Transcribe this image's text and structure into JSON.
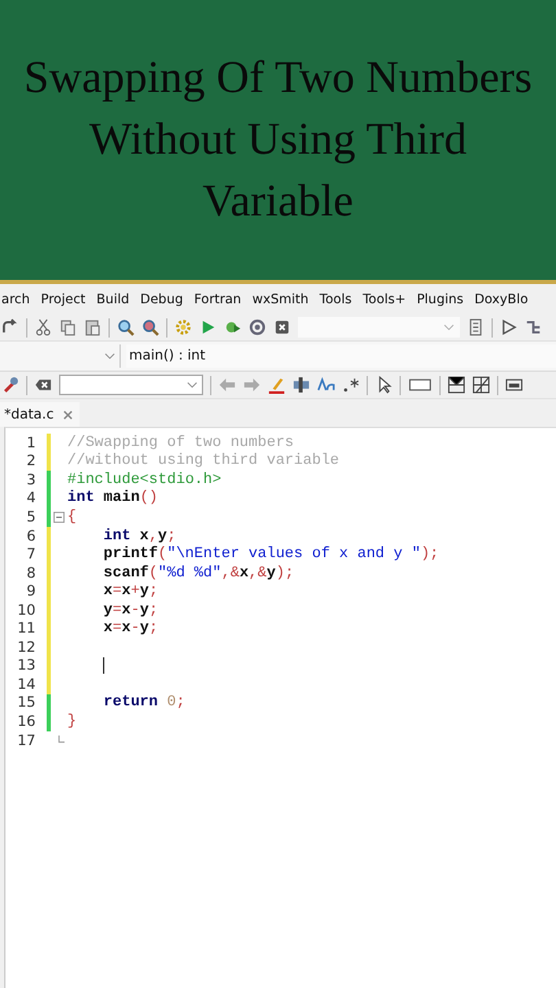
{
  "banner": {
    "title": "Swapping Of Two Numbers Without Using Third Variable"
  },
  "menu": [
    "arch",
    "Project",
    "Build",
    "Debug",
    "Fortran",
    "wxSmith",
    "Tools",
    "Tools+",
    "Plugins",
    "DoxyBlo"
  ],
  "scope": {
    "function": "main() : int"
  },
  "tabs": [
    {
      "label": "*data.c",
      "selected": true
    }
  ],
  "editor": {
    "lines": [
      {
        "number": "1",
        "saved": false,
        "indent": false,
        "tokens": [
          {
            "kind": "comment",
            "text": "//Swapping of two numbers"
          }
        ]
      },
      {
        "number": "2",
        "saved": false,
        "indent": false,
        "tokens": [
          {
            "kind": "comment",
            "text": "//without using third variable"
          }
        ]
      },
      {
        "number": "3",
        "saved": true,
        "indent": false,
        "tokens": [
          {
            "kind": "preproc",
            "text": "#include<stdio.h>"
          }
        ]
      },
      {
        "number": "4",
        "saved": true,
        "indent": false,
        "tokens": [
          {
            "kind": "keyword",
            "text": "int"
          },
          {
            "kind": "plain",
            "text": " main"
          },
          {
            "kind": "punct",
            "text": "()"
          }
        ]
      },
      {
        "number": "5",
        "saved": true,
        "indent": false,
        "fold": true,
        "tokens": [
          {
            "kind": "punct",
            "text": "{"
          }
        ]
      },
      {
        "number": "6",
        "saved": false,
        "indent": true,
        "tokens": [
          {
            "kind": "keyword",
            "text": "int"
          },
          {
            "kind": "plain",
            "text": " x"
          },
          {
            "kind": "punct",
            "text": ","
          },
          {
            "kind": "plain",
            "text": "y"
          },
          {
            "kind": "punct",
            "text": ";"
          }
        ]
      },
      {
        "number": "7",
        "saved": false,
        "indent": true,
        "tokens": [
          {
            "kind": "plain",
            "text": "printf"
          },
          {
            "kind": "punct",
            "text": "("
          },
          {
            "kind": "string",
            "text": "\"\\nEnter values of x and y \""
          },
          {
            "kind": "punct",
            "text": ");"
          }
        ]
      },
      {
        "number": "8",
        "saved": false,
        "indent": true,
        "tokens": [
          {
            "kind": "plain",
            "text": "scanf"
          },
          {
            "kind": "punct",
            "text": "("
          },
          {
            "kind": "string",
            "text": "\"%d %d\""
          },
          {
            "kind": "punct",
            "text": ",&"
          },
          {
            "kind": "plain",
            "text": "x"
          },
          {
            "kind": "punct",
            "text": ",&"
          },
          {
            "kind": "plain",
            "text": "y"
          },
          {
            "kind": "punct",
            "text": ");"
          }
        ]
      },
      {
        "number": "9",
        "saved": false,
        "indent": true,
        "tokens": [
          {
            "kind": "plain",
            "text": "x"
          },
          {
            "kind": "punct",
            "text": "="
          },
          {
            "kind": "plain",
            "text": "x"
          },
          {
            "kind": "punct",
            "text": "+"
          },
          {
            "kind": "plain",
            "text": "y"
          },
          {
            "kind": "punct",
            "text": ";"
          }
        ]
      },
      {
        "number": "10",
        "saved": false,
        "indent": true,
        "tokens": [
          {
            "kind": "plain",
            "text": "y"
          },
          {
            "kind": "punct",
            "text": "="
          },
          {
            "kind": "plain",
            "text": "x"
          },
          {
            "kind": "punct",
            "text": "-"
          },
          {
            "kind": "plain",
            "text": "y"
          },
          {
            "kind": "punct",
            "text": ";"
          }
        ]
      },
      {
        "number": "11",
        "saved": false,
        "indent": true,
        "tokens": [
          {
            "kind": "plain",
            "text": "x"
          },
          {
            "kind": "punct",
            "text": "="
          },
          {
            "kind": "plain",
            "text": "x"
          },
          {
            "kind": "punct",
            "text": "-"
          },
          {
            "kind": "plain",
            "text": "y"
          },
          {
            "kind": "punct",
            "text": ";"
          }
        ]
      },
      {
        "number": "12",
        "saved": false
      },
      {
        "number": "13",
        "saved": false,
        "indent": true,
        "cursor": true
      },
      {
        "number": "14",
        "saved": false
      },
      {
        "number": "15",
        "saved": true,
        "indent": true,
        "tokens": [
          {
            "kind": "keyword",
            "text": "return"
          },
          {
            "kind": "number",
            "text": " 0"
          },
          {
            "kind": "punct",
            "text": ";"
          }
        ]
      },
      {
        "number": "16",
        "saved": true,
        "indent": false,
        "tokens": [
          {
            "kind": "punct",
            "text": "}"
          }
        ]
      },
      {
        "number": "17",
        "foldEnd": true
      }
    ]
  }
}
